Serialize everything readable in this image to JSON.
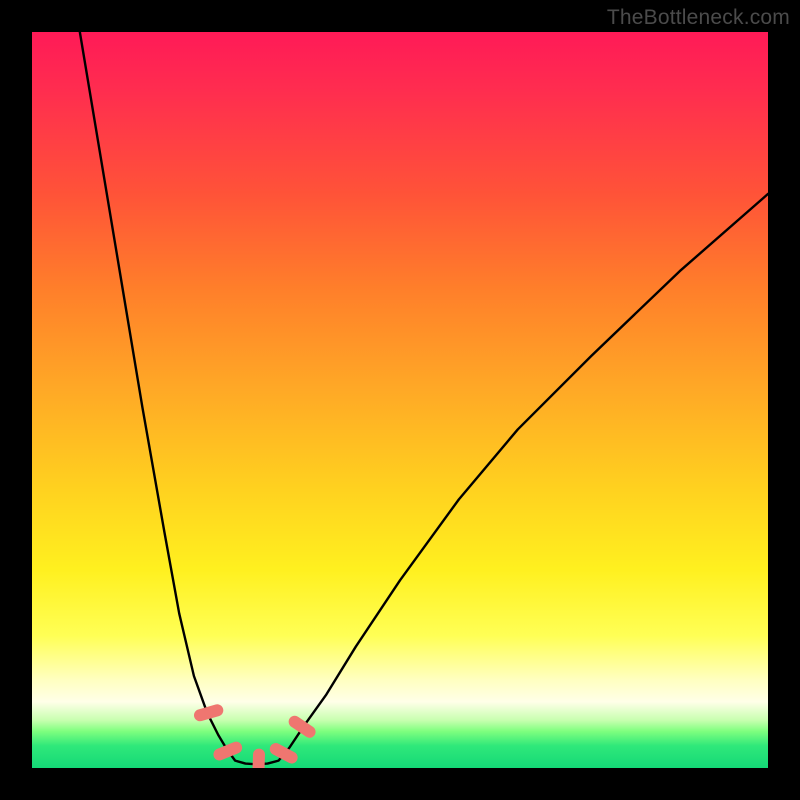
{
  "watermark": "TheBottleneck.com",
  "chart_data": {
    "type": "line",
    "title": "",
    "xlabel": "",
    "ylabel": "",
    "xlim": [
      0,
      100
    ],
    "ylim": [
      0,
      100
    ],
    "grid": false,
    "legend": false,
    "note": "Values are read from pixel positions; axes are unlabeled in the source image, so x/y are expressed as 0–100 percent of the plot area (x left→right, y bottom→top).",
    "series": [
      {
        "name": "left-branch",
        "x": [
          6.5,
          9,
          12,
          15,
          18,
          20,
          22,
          23.8,
          25.3,
          26.5,
          27.6
        ],
        "y": [
          100,
          85,
          67,
          49,
          32,
          21,
          12.5,
          7.5,
          4.5,
          2.5,
          1
        ]
      },
      {
        "name": "valley-floor",
        "x": [
          27.6,
          29,
          30.5,
          32,
          33.5
        ],
        "y": [
          1,
          0.6,
          0.5,
          0.6,
          1
        ]
      },
      {
        "name": "right-branch",
        "x": [
          33.5,
          35,
          37,
          40,
          44,
          50,
          58,
          66,
          76,
          88,
          100
        ],
        "y": [
          1,
          2.8,
          5.8,
          10,
          16.5,
          25.5,
          36.5,
          46,
          56,
          67.5,
          78
        ]
      }
    ],
    "markers": [
      {
        "name": "left-marker-upper",
        "x": 24.0,
        "y": 7.5,
        "angle_deg": 74
      },
      {
        "name": "left-marker-lower",
        "x": 26.6,
        "y": 2.3,
        "angle_deg": 68
      },
      {
        "name": "valley-marker",
        "x": 30.8,
        "y": 0.6,
        "angle_deg": 2
      },
      {
        "name": "right-marker-lower",
        "x": 34.2,
        "y": 2.0,
        "angle_deg": -62
      },
      {
        "name": "right-marker-upper",
        "x": 36.7,
        "y": 5.6,
        "angle_deg": -56
      }
    ],
    "colors": {
      "curve": "#000000",
      "marker": "#ef7670",
      "background_top": "#ff1a57",
      "background_bottom": "#14d977",
      "frame": "#000000"
    }
  }
}
